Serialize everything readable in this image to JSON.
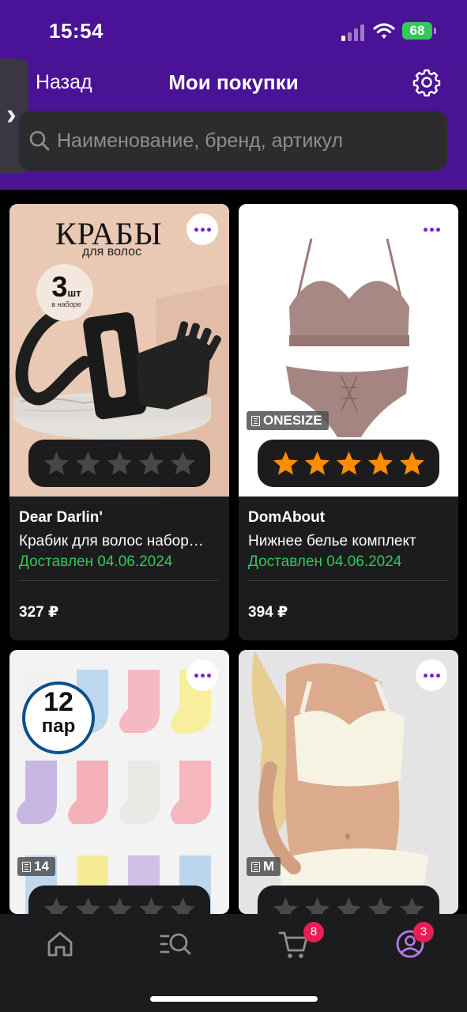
{
  "status_bar": {
    "time": "15:54",
    "battery": "68"
  },
  "nav": {
    "back_label": "Назад",
    "title": "Мои покупки"
  },
  "search": {
    "placeholder": "Наименование, бренд, артикул"
  },
  "products": [
    {
      "brand": "Dear Darlin'",
      "name": "Крабик для волос набор…",
      "status": "Доставлен 04.06.2024",
      "price": "327 ₽",
      "rating": 0,
      "image_title": "КРАБЫ",
      "image_subtitle": "для волос",
      "image_badge_big": "3",
      "image_badge_unit": "шт",
      "image_badge_small": "в наборе"
    },
    {
      "brand": "DomAbout",
      "name": "Нижнее белье комплект",
      "status": "Доставлен 04.06.2024",
      "price": "394 ₽",
      "rating": 5,
      "size": "ONESIZE"
    },
    {
      "size": "14",
      "rating": 0,
      "image_badge_big": "12",
      "image_badge_unit": "пар"
    },
    {
      "size": "M",
      "rating": 0
    }
  ],
  "tabbar": {
    "cart_badge": "8",
    "profile_badge": "3"
  },
  "colors": {
    "header": "#4a1296",
    "accent": "#7b1fd6",
    "star_filled": "#ff8c00",
    "star_empty": "#48484a",
    "delivered": "#34c759",
    "badge": "#ea1d55"
  },
  "icons": [
    "chevron-right-icon",
    "gear-icon",
    "search-icon",
    "more-icon",
    "size-icon",
    "star-icon",
    "home-icon",
    "catalog-search-icon",
    "cart-icon",
    "profile-icon"
  ]
}
